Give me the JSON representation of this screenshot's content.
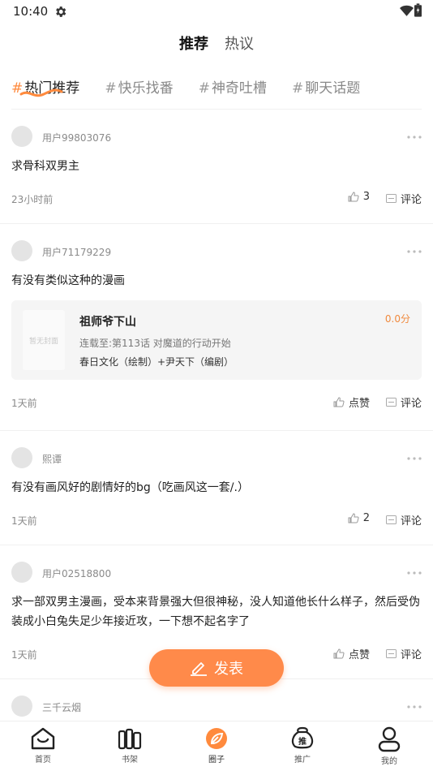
{
  "status_bar": {
    "time": "10:40"
  },
  "top_tabs": [
    {
      "label": "推荐",
      "active": true
    },
    {
      "label": "热议",
      "active": false
    }
  ],
  "topics": [
    {
      "hash": "#",
      "label": "热门推荐",
      "active": true
    },
    {
      "hash": "#",
      "label": "快乐找番",
      "active": false
    },
    {
      "hash": "#",
      "label": "神奇吐槽",
      "active": false
    },
    {
      "hash": "#",
      "label": "聊天话题",
      "active": false
    }
  ],
  "posts": [
    {
      "username": "用户99803076",
      "body": "求骨科双男主",
      "time": "23小时前",
      "like_label": "3",
      "comment_label": "评论"
    },
    {
      "username": "用户71179229",
      "body": "有没有类似这种的漫画",
      "time": "1天前",
      "like_label": "点赞",
      "comment_label": "评论",
      "book": {
        "cover_text": "暂无封面",
        "title": "祖师爷下山",
        "score": "0.0分",
        "progress": "连载至:第113话 对魔道的行动开始",
        "authors": "春日文化（绘制）+尹天下（编剧）"
      }
    },
    {
      "username": "熙谭",
      "body": "有没有画风好的剧情好的bg（吃画风这一套/.）",
      "time": "1天前",
      "like_label": "2",
      "comment_label": "评论"
    },
    {
      "username": "用户02518800",
      "body": "求一部双男主漫画，受本来背景强大但很神秘，没人知道他长什么样子，然后受伪装成小白兔失足少年接近攻，一下想不起名字了",
      "time": "1天前",
      "like_label": "点赞",
      "comment_label": "评论"
    },
    {
      "username": "三千云烟"
    }
  ],
  "fab": {
    "label": "发表"
  },
  "bottom_nav": [
    {
      "label": "首页",
      "icon": "home-icon"
    },
    {
      "label": "书架",
      "icon": "bookshelf-icon"
    },
    {
      "label": "圈子",
      "icon": "circle-icon",
      "active": true
    },
    {
      "label": "推广",
      "icon": "promote-icon"
    },
    {
      "label": "我的",
      "icon": "profile-icon"
    }
  ],
  "colors": {
    "accent": "#ff8a3d",
    "fab": "#ff8a4a",
    "score": "#f08a3e"
  }
}
